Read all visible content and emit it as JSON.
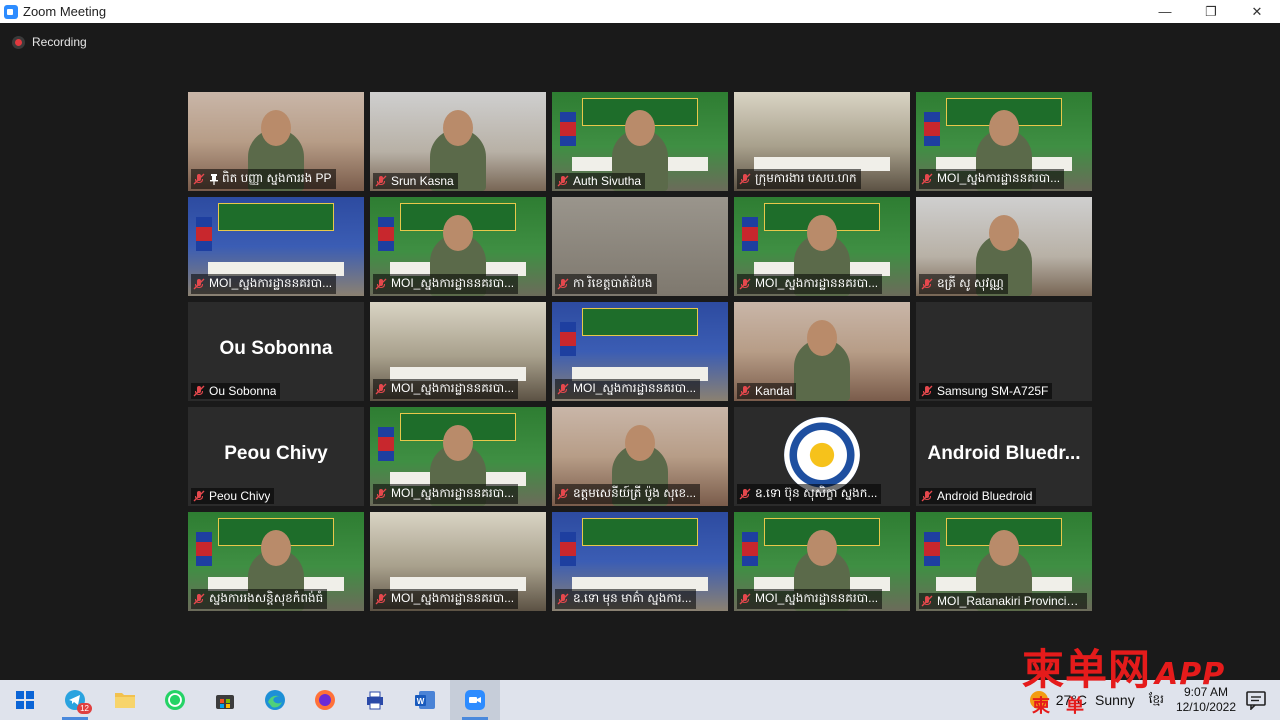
{
  "window": {
    "title": "Zoom Meeting",
    "minimize": "—",
    "restore": "❐",
    "close": "✕"
  },
  "recording": {
    "label": "Recording"
  },
  "participants": [
    {
      "name": "ពិត បញ្ញា ស្នងការរង PP",
      "pinned": true,
      "scene": "s-skin"
    },
    {
      "name": "Srun Kasna",
      "scene": "s-room"
    },
    {
      "name": "Auth Sivutha",
      "scene": "s-green"
    },
    {
      "name": "ក្រុមការងារ បសប.ហក",
      "scene": "s-meeting",
      "active": true
    },
    {
      "name": "MOI_ស្នងការដ្ឋាននគរបា...",
      "scene": "s-green"
    },
    {
      "name": "MOI_ស្នងការដ្ឋាននគរបា...",
      "scene": "s-blue"
    },
    {
      "name": "MOI_ស្នងការដ្ឋាននគរបា...",
      "scene": "s-green"
    },
    {
      "name": "កា រិខេត្តបាត់ដំបង",
      "scene": "s-grey"
    },
    {
      "name": "MOI_ស្នងការដ្ឋាននគរបា...",
      "scene": "s-green"
    },
    {
      "name": "ឧត្រី សូ សុវណ្ណ",
      "scene": "s-room"
    },
    {
      "name": "Ou Sobonna",
      "bigname": "Ou Sobonna",
      "scene": "s-dark"
    },
    {
      "name": "MOI_ស្នងការដ្ឋាននគរបា...",
      "scene": "s-meeting"
    },
    {
      "name": "MOI_ស្នងការដ្ឋាននគរបា...",
      "scene": "s-blue"
    },
    {
      "name": "Kandal",
      "scene": "s-skin"
    },
    {
      "name": "Samsung SM-A725F",
      "scene": "s-dark"
    },
    {
      "name": "Peou Chivy",
      "bigname": "Peou Chivy",
      "scene": "s-dark"
    },
    {
      "name": "MOI_ស្នងការដ្ឋាននគរបា...",
      "scene": "s-green"
    },
    {
      "name": "ឧត្តមសេនីយ៍ត្រី ប៉ូង សុខេ...",
      "scene": "s-skin"
    },
    {
      "name": "ឧ.ទោ ប៊ុន សុសិក្ខា ស្នងក...",
      "scene": "s-dark",
      "logo": true
    },
    {
      "name": "Android Bluedroid",
      "bigname": "Android  Bluedr...",
      "scene": "s-dark"
    },
    {
      "name": "ស្នងការរងសន្តិសុខកំពង់ធំ",
      "scene": "s-green"
    },
    {
      "name": "MOI_ស្នងការដ្ឋាននគរបា...",
      "scene": "s-meeting"
    },
    {
      "name": "ឧ.ទោ មុន មាគ៌ា ស្នងការ...",
      "scene": "s-blue"
    },
    {
      "name": "MOI_ស្នងការដ្ឋាននគរបា...",
      "scene": "s-green"
    },
    {
      "name": "MOI_Ratanakiri Provincia...",
      "scene": "s-green"
    }
  ],
  "taskbar": {
    "apps": [
      {
        "id": "start",
        "icon": "windows-start-icon"
      },
      {
        "id": "telegram",
        "icon": "telegram-icon",
        "badge": "12"
      },
      {
        "id": "explorer",
        "icon": "folder-icon"
      },
      {
        "id": "whatsapp",
        "icon": "whatsapp-icon"
      },
      {
        "id": "store",
        "icon": "store-icon"
      },
      {
        "id": "edge",
        "icon": "edge-icon"
      },
      {
        "id": "firefox",
        "icon": "firefox-icon"
      },
      {
        "id": "printer",
        "icon": "printer-icon"
      },
      {
        "id": "word",
        "icon": "word-icon"
      },
      {
        "id": "zoom",
        "icon": "zoom-icon"
      }
    ],
    "weather": {
      "temp": "27°C",
      "condition": "Sunny"
    },
    "lang": "ខ្មែរ",
    "time": "9:07 AM",
    "date": "12/10/2022"
  },
  "watermark": {
    "main": "柬单网",
    "app": "APP",
    "sub": "柬单"
  }
}
